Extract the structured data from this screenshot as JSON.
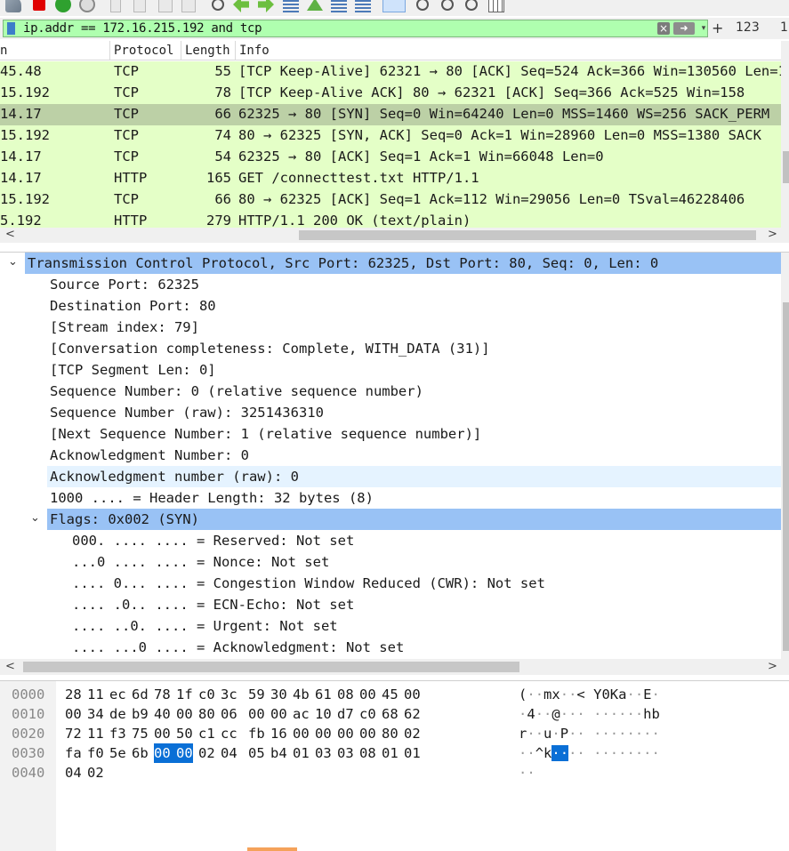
{
  "filter": {
    "text": "ip.addr == 172.16.215.192 and tcp",
    "clear_icon": "×",
    "apply_icon": "➜",
    "dropdown_icon": "▾",
    "add_label": "+",
    "count_a": "123",
    "count_b": "1"
  },
  "packet_list": {
    "columns": [
      {
        "label": "n"
      },
      {
        "label": "Protocol"
      },
      {
        "label": "Length"
      },
      {
        "label": "Info"
      }
    ],
    "rows": [
      {
        "src": "45.48",
        "protocol": "TCP",
        "length": "55",
        "info": "[TCP Keep-Alive] 62321 → 80 [ACK] Seq=524 Ack=366 Win=130560 Len=1",
        "selected": false
      },
      {
        "src": "15.192",
        "protocol": "TCP",
        "length": "78",
        "info": "[TCP Keep-Alive ACK] 80 → 62321 [ACK] Seq=366 Ack=525 Win=158",
        "selected": false
      },
      {
        "src": "14.17",
        "protocol": "TCP",
        "length": "66",
        "info": "62325 → 80 [SYN] Seq=0 Win=64240 Len=0 MSS=1460 WS=256 SACK_PERM",
        "selected": true
      },
      {
        "src": "15.192",
        "protocol": "TCP",
        "length": "74",
        "info": "80 → 62325 [SYN, ACK] Seq=0 Ack=1 Win=28960 Len=0 MSS=1380 SACK",
        "selected": false
      },
      {
        "src": "14.17",
        "protocol": "TCP",
        "length": "54",
        "info": "62325 → 80 [ACK] Seq=1 Ack=1 Win=66048 Len=0",
        "selected": false
      },
      {
        "src": "14.17",
        "protocol": "HTTP",
        "length": "165",
        "info": "GET /connecttest.txt HTTP/1.1",
        "selected": false
      },
      {
        "src": "15.192",
        "protocol": "TCP",
        "length": "66",
        "info": "80 → 62325 [ACK] Seq=1 Ack=112 Win=29056 Len=0 TSval=46228406",
        "selected": false
      },
      {
        "src": "5.192",
        "protocol": "HTTP",
        "length": "279",
        "info": "HTTP/1.1 200 OK  (text/plain)",
        "selected": false
      }
    ]
  },
  "details": {
    "header": "Transmission Control Protocol, Src Port: 62325, Dst Port: 80, Seq: 0, Len: 0",
    "fields": [
      "Source Port: 62325",
      "Destination Port: 80",
      "[Stream index: 79]",
      "[Conversation completeness: Complete, WITH_DATA (31)]",
      "[TCP Segment Len: 0]",
      "Sequence Number: 0    (relative sequence number)",
      "Sequence Number (raw): 3251436310",
      "[Next Sequence Number: 1    (relative sequence number)]",
      "Acknowledgment Number: 0",
      "Acknowledgment number (raw): 0",
      "1000 .... = Header Length: 32 bytes (8)"
    ],
    "flags_label": "Flags: 0x002 (SYN)",
    "flag_bits": [
      "000. .... .... = Reserved: Not set",
      "...0 .... .... = Nonce: Not set",
      ".... 0... .... = Congestion Window Reduced (CWR): Not set",
      ".... .0.. .... = ECN-Echo: Not set",
      ".... ..0. .... = Urgent: Not set",
      ".... ...0 .... = Acknowledgment: Not set"
    ]
  },
  "bytes": {
    "rows": [
      {
        "offset": "0000",
        "hex": [
          "28",
          "11",
          "ec",
          "6d",
          "78",
          "1f",
          "c0",
          "3c",
          "59",
          "30",
          "4b",
          "61",
          "08",
          "00",
          "45",
          "00"
        ],
        "ascii": [
          "(",
          "·",
          "·",
          "m",
          "x",
          "·",
          "·",
          "<",
          " ",
          "Y",
          "0",
          "K",
          "a",
          "·",
          "·",
          "E",
          "·"
        ]
      },
      {
        "offset": "0010",
        "hex": [
          "00",
          "34",
          "de",
          "b9",
          "40",
          "00",
          "80",
          "06",
          "00",
          "00",
          "ac",
          "10",
          "d7",
          "c0",
          "68",
          "62"
        ],
        "ascii": [
          "·",
          "4",
          "·",
          "·",
          "@",
          "·",
          "·",
          "·",
          " ",
          "·",
          "·",
          "·",
          "·",
          "·",
          "·",
          "h",
          "b"
        ]
      },
      {
        "offset": "0020",
        "hex": [
          "72",
          "11",
          "f3",
          "75",
          "00",
          "50",
          "c1",
          "cc",
          "fb",
          "16",
          "00",
          "00",
          "00",
          "00",
          "80",
          "02"
        ],
        "ascii": [
          "r",
          "·",
          "·",
          "u",
          "·",
          "P",
          "·",
          "·",
          " ",
          "·",
          "·",
          "·",
          "·",
          "·",
          "·",
          "·",
          "·"
        ]
      },
      {
        "offset": "0030",
        "hex": [
          "fa",
          "f0",
          "5e",
          "6b",
          "00",
          "00",
          "02",
          "04",
          "05",
          "b4",
          "01",
          "03",
          "03",
          "08",
          "01",
          "01"
        ],
        "ascii": [
          "·",
          "·",
          "^",
          "k",
          "·",
          "·",
          "·",
          "·",
          " ",
          "·",
          "·",
          "·",
          "·",
          "·",
          "·",
          "·",
          "·"
        ]
      },
      {
        "offset": "0040",
        "hex": [
          "04",
          "02"
        ],
        "ascii": [
          "·",
          "·"
        ]
      }
    ],
    "highlight": {
      "row": 3,
      "start": 4,
      "end": 5
    }
  },
  "colors": {
    "packet_row": "#e4ffc7",
    "selected_row": "#bcd0a6",
    "filter_valid": "#afffaf",
    "tree_selected": "#99c2f5",
    "byte_highlight": "#0a6fd6"
  },
  "icons": [
    "shark-fin-icon",
    "stop-icon",
    "restart-icon",
    "options-icon",
    "open-icon",
    "save-icon",
    "close-file-icon",
    "reload-icon",
    "find-icon",
    "go-back-icon",
    "go-forward-icon",
    "go-to-packet-icon",
    "first-packet-icon",
    "last-packet-icon",
    "autoscroll-icon",
    "colorize-icon",
    "zoom-in-icon",
    "zoom-out-icon",
    "zoom-reset-icon",
    "resize-columns-icon"
  ]
}
